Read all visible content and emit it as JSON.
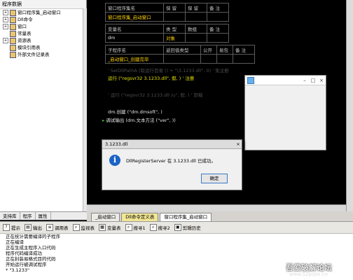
{
  "project_tree": {
    "title": "程序数据",
    "items": [
      {
        "label": "窗口程序集_启动窗口",
        "expand": "+"
      },
      {
        "label": "Dll命令",
        "expand": "+"
      },
      {
        "label": "窗口",
        "expand": "+"
      },
      {
        "label": "常量表",
        "expand": ""
      },
      {
        "label": "资源表",
        "expand": "+"
      },
      {
        "label": "模块引用表",
        "expand": ""
      },
      {
        "label": "外部文件记录表",
        "expand": ""
      }
    ]
  },
  "left_tabs": [
    "支持库",
    "程序",
    "属性"
  ],
  "code": {
    "asm_header": {
      "c1": "窗口程序集名",
      "c2": "保 留",
      "c3": "保 留",
      "c4": "备 注"
    },
    "asm_row": {
      "c1": "窗口程序集_启动窗口",
      "c2": "",
      "c3": "",
      "c4": ""
    },
    "var_header": {
      "c1": "变量名",
      "c2": "类 型",
      "c3": "数组",
      "c4": "备 注"
    },
    "var_row": {
      "c1": "dm",
      "c2": "对象",
      "c3": "",
      "c4": ""
    },
    "sub_header": {
      "c1": "子程序名",
      "c2": "返回值类型",
      "c3": "公开",
      "c4": "易包",
      "c5": "备 注"
    },
    "sub_row": {
      "c1": "_启动窗口_创建完毕",
      "c2": "",
      "c3": "",
      "c4": "",
      "c5": ""
    },
    "line1": "' SetDllPathA (取运行目录 () + \"\\3.1233.dll\", 0)  ' 免注册",
    "line2": "运行 (\"regsvr32 3.1233.dll\", 假, )  ' 注册",
    "line3": "' 运行 (\"regsvr32 3.1233.dll /u\", 假, )  ' 卸载",
    "line4": "dm.创建 (\"dm.dmsoft\", )",
    "line5": "调试输出 (dm.文本方法 (\"ver\", ))"
  },
  "editor_tabs": [
    "_启动窗口",
    "Dll命令定义表",
    "窗口程序集_启动窗口"
  ],
  "output_toolbar": [
    "提示",
    "输出",
    "调用表",
    "监视表",
    "变量表",
    "搜寻1",
    "搜寻2",
    "剪辑历史"
  ],
  "output_lines": [
    "正在统计需要编译的子程序",
    "正在编译",
    "正在生成主程序入口代码",
    "程序代码编译成功",
    "正在封装易格式目的代码",
    "开始运行被调试程序",
    "* \"3.1233\""
  ],
  "watermark": {
    "line1": "吾爱破解论坛",
    "line2": "www.52pojie.cn"
  },
  "dialog": {
    "title": "3.1233.dll",
    "message": "DllRegisterServer 在 3.1233.dll 已成功。",
    "ok": "确定",
    "close": "×"
  },
  "run_window": {
    "min": "–",
    "max": "□",
    "close": "×"
  }
}
